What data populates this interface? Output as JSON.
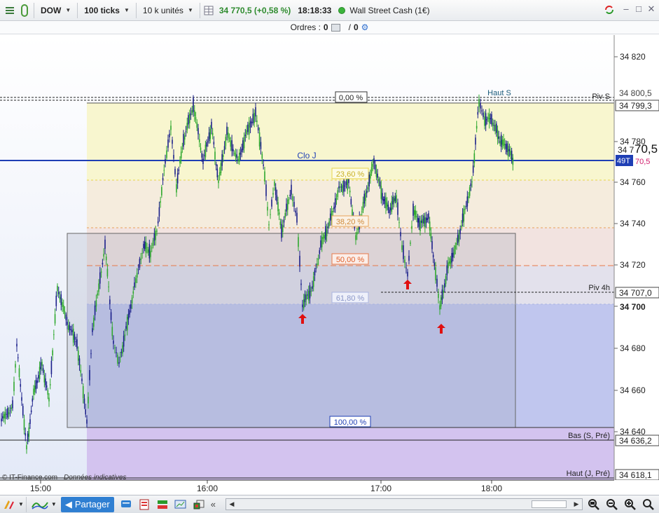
{
  "toolbar": {
    "instrument_code": "DOW",
    "tick_setting": "100 ticks",
    "volume_setting": "10 k unités",
    "price_change": "34 770,5 (+0,58 %)",
    "time": "18:18:33",
    "instrument_name": "Wall Street Cash (1€)"
  },
  "orders": {
    "label": "Ordres :",
    "count_a": "0",
    "separator": "/",
    "count_b": "0"
  },
  "chart": {
    "watermark": "© IT-Finance.com",
    "watermark_note": "Données indicatives",
    "y_ticks": [
      "34 820",
      "34 780",
      "34 760",
      "34 740",
      "34 720",
      "34 700",
      "34 680",
      "34 660",
      "34 640"
    ],
    "x_ticks": [
      "15:00",
      "16:00",
      "17:00",
      "18:00"
    ],
    "level_labels": {
      "piv_s": "Piv S",
      "piv_4h": "Piv 4h",
      "clo_j": "Clo J",
      "haut_s": "Haut S",
      "bas_s_pre": "Bas (S, Pré)",
      "haut_j_pre": "Haut (J, Pré)"
    },
    "price_tags": {
      "p34800_5": "34 800,5",
      "p34799_3": "34 799,3",
      "p34707_0": "34 707,0",
      "p34636_2": "34 636,2",
      "p34618_1": "34 618,1",
      "last_big": "70,5",
      "last_prefix": "34 7",
      "ticks_left": "49T",
      "pink_value": "70,5"
    },
    "fib_labels": [
      "0,00 %",
      "23,60 %",
      "38,20 %",
      "50,00 %",
      "61,80 %",
      "100,00 %"
    ],
    "colors": {
      "line_blue": "#1f3fb5",
      "up_candle": "#2ea82e",
      "down_candle": "#1a1f8a",
      "arrow_red": "#e01010",
      "price_green": "#2e8b2e"
    }
  },
  "bottom": {
    "share_label": "Partager"
  }
}
